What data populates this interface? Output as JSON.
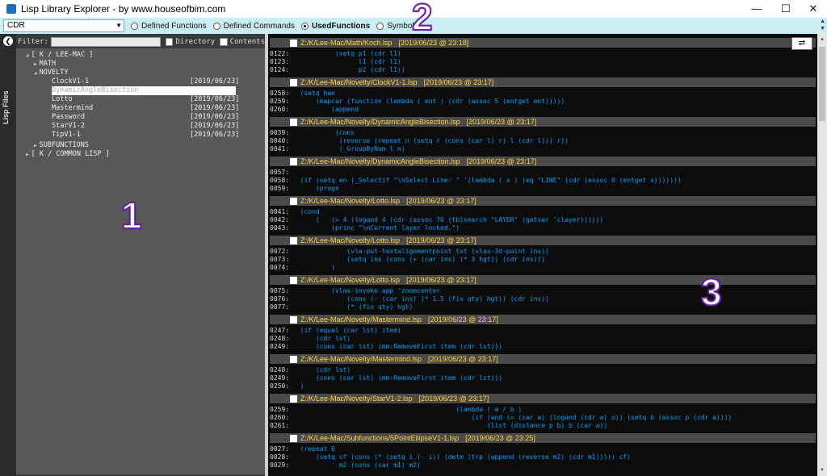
{
  "window": {
    "title": "Lisp Library Explorer - by www.houseofbim.com",
    "minimize": "—",
    "maximize": "☐",
    "close": "✕"
  },
  "toolbar": {
    "combo_value": "CDR",
    "radios": [
      {
        "label": "Defined Functions",
        "selected": false
      },
      {
        "label": "Defined Commands",
        "selected": false
      },
      {
        "label": "UsedFunctions",
        "selected": true
      },
      {
        "label": "Symbols",
        "selected": false
      }
    ]
  },
  "side": {
    "collapse": "❮",
    "label": "Lisp Files"
  },
  "left": {
    "filter_label": "Filter:",
    "filter_value": "",
    "directory_label": "Directory",
    "contents_label": "Contents",
    "tree": [
      {
        "label": "[ K / LEE-MAC ]",
        "date": "",
        "indent": 1,
        "arrow": "◢"
      },
      {
        "label": "MATH",
        "date": "",
        "indent": 2,
        "arrow": "▶"
      },
      {
        "label": "NOVELTY",
        "date": "",
        "indent": 2,
        "arrow": "◢"
      },
      {
        "label": "ClockV1-1",
        "date": "[2019/06/23]",
        "indent": 3,
        "arrow": ""
      },
      {
        "label": "DynamicAngleBisection",
        "date": "",
        "indent": 3,
        "arrow": "",
        "selected": true
      },
      {
        "label": "Lotto",
        "date": "[2019/06/23]",
        "indent": 3,
        "arrow": ""
      },
      {
        "label": "Mastermind",
        "date": "[2019/06/23]",
        "indent": 3,
        "arrow": ""
      },
      {
        "label": "Password",
        "date": "[2019/06/23]",
        "indent": 3,
        "arrow": ""
      },
      {
        "label": "StarV1-2",
        "date": "[2019/06/23]",
        "indent": 3,
        "arrow": ""
      },
      {
        "label": "TipV1-1",
        "date": "[2019/06/23]",
        "indent": 3,
        "arrow": ""
      },
      {
        "label": "SUBFUNCTIONS",
        "date": "",
        "indent": 2,
        "arrow": "▶"
      },
      {
        "label": "[ K / COMMON LISP ]",
        "date": "",
        "indent": 1,
        "arrow": "▶"
      }
    ]
  },
  "right": {
    "toggle": "⇄",
    "blocks": [
      {
        "file": "Z:/K/Lee-Mac/Math/Koch.lsp",
        "date": "[2019/06/23 @ 23:18]",
        "lines": [
          {
            "n": "0122:",
            "t": "           (setq p1 (cdr l1)"
          },
          {
            "n": "0123:",
            "t": "                 l1 (cdr l1)"
          },
          {
            "n": "0124:",
            "t": "                 p2 (cdr l1))"
          }
        ]
      },
      {
        "file": "Z:/K/Lee-Mac/Novelty/ClockV1-1.lsp",
        "date": "[2019/06/23 @ 23:17]",
        "lines": [
          {
            "n": "0258:",
            "t": "  (setq han"
          },
          {
            "n": "0259:",
            "t": "      (mapcar (function (lambda ( ent ) (cdr (assoc 5 (entget ent)))))"
          },
          {
            "n": "0260:",
            "t": "          (append"
          }
        ]
      },
      {
        "file": "Z:/K/Lee-Mac/Novelty/DynamicAngleBisection.lsp",
        "date": "[2019/06/23 @ 23:17]",
        "lines": [
          {
            "n": "0039:",
            "t": "           (cons"
          },
          {
            "n": "0040:",
            "t": "            (reverse (repeat n (setq r (cons (car l) r) l (cdr l))) r))"
          },
          {
            "n": "0041:",
            "t": "            (_GroupByNum l n)"
          }
        ]
      },
      {
        "file": "Z:/K/Lee-Mac/Novelty/DynamicAngleBisection.lsp",
        "date": "[2019/06/23 @ 23:17]",
        "lines": [
          {
            "n": "0057:",
            "t": ""
          },
          {
            "n": "0058:",
            "t": "  (if (setq en (_Selectif \"\\nSelect Line: \" '(lambda ( x ) (eq \"LINE\" (cdr (assoc 0 (entget x)))))))"
          },
          {
            "n": "0059:",
            "t": "      (progn"
          }
        ]
      },
      {
        "file": "Z:/K/Lee-Mac/Novelty/Lotto.lsp",
        "date": "[2019/06/23 @ 23:17]",
        "lines": [
          {
            "n": "0041:",
            "t": "  (cond"
          },
          {
            "n": "0042:",
            "t": "      (   (= 4 (logand 4 (cdr (assoc 70 (tblsearch \"LAYER\" (getvar 'clayer))))))"
          },
          {
            "n": "0043:",
            "t": "          (princ \"\\nCurrent layer locked.\")"
          }
        ]
      },
      {
        "file": "Z:/K/Lee-Mac/Novelty/Lotto.lsp",
        "date": "[2019/06/23 @ 23:17]",
        "lines": [
          {
            "n": "0072:",
            "t": "              (vla-put-textalignmentpoint txt (vlax-3d-point ins))"
          },
          {
            "n": "0073:",
            "t": "              (setq ins (cons (+ (car ins) (* 3 hgt)) (cdr ins)))"
          },
          {
            "n": "0074:",
            "t": "          )"
          }
        ]
      },
      {
        "file": "Z:/K/Lee-Mac/Novelty/Lotto.lsp",
        "date": "[2019/06/23 @ 23:17]",
        "lines": [
          {
            "n": "0075:",
            "t": "          (vlax-invoke app 'zoomcenter"
          },
          {
            "n": "0076:",
            "t": "              (cons (- (car ins) (* 1.5 (fix qty) hgt)) (cdr ins))"
          },
          {
            "n": "0077:",
            "t": "              (* (fix qty) hgt)"
          }
        ]
      },
      {
        "file": "Z:/K/Lee-Mac/Novelty/Mastermind.lsp",
        "date": "[2019/06/23 @ 23:17]",
        "lines": [
          {
            "n": "0247:",
            "t": "  (if (equal (car lst) item)"
          },
          {
            "n": "0248:",
            "t": "      (cdr lst)"
          },
          {
            "n": "0249:",
            "t": "      (cons (car lst) (mm:RemoveFirst item (cdr lst)))"
          }
        ]
      },
      {
        "file": "Z:/K/Lee-Mac/Novelty/Mastermind.lsp",
        "date": "[2019/06/23 @ 23:17]",
        "lines": [
          {
            "n": "0248:",
            "t": "      (cdr lst)"
          },
          {
            "n": "0249:",
            "t": "      (cons (car lst) (mm:RemoveFirst item (cdr lst)))"
          },
          {
            "n": "0250:",
            "t": "  )"
          }
        ]
      },
      {
        "file": "Z:/K/Lee-Mac/Novelty/StarV1-2.lsp",
        "date": "[2019/06/23 @ 23:17]",
        "lines": [
          {
            "n": "0259:",
            "t": "                                          (lambda ( a / b )"
          },
          {
            "n": "0260:",
            "t": "                                              (if (and (= (car a) (logand (cdr a) o)) (setq b (assoc p (cdr a))))"
          },
          {
            "n": "0261:",
            "t": "                                                  (list (distance p b) b (car a))"
          }
        ]
      },
      {
        "file": "Z:/K/Lee-Mac/Subfunctions/5PointEllipseV1-1.lsp",
        "date": "[2019/06/23 @ 23:25]",
        "lines": [
          {
            "n": "0027:",
            "t": "  (repeat 6"
          },
          {
            "n": "0028:",
            "t": "      (setq cf (cons (* (setq i (- i)) (detm (trp (append (reverse m2) (cdr m1))))) cf)"
          },
          {
            "n": "0029:",
            "t": "            m2 (cons (car m1) m2)"
          }
        ]
      }
    ]
  },
  "callouts": {
    "one": "1",
    "two": "2",
    "three": "3"
  }
}
